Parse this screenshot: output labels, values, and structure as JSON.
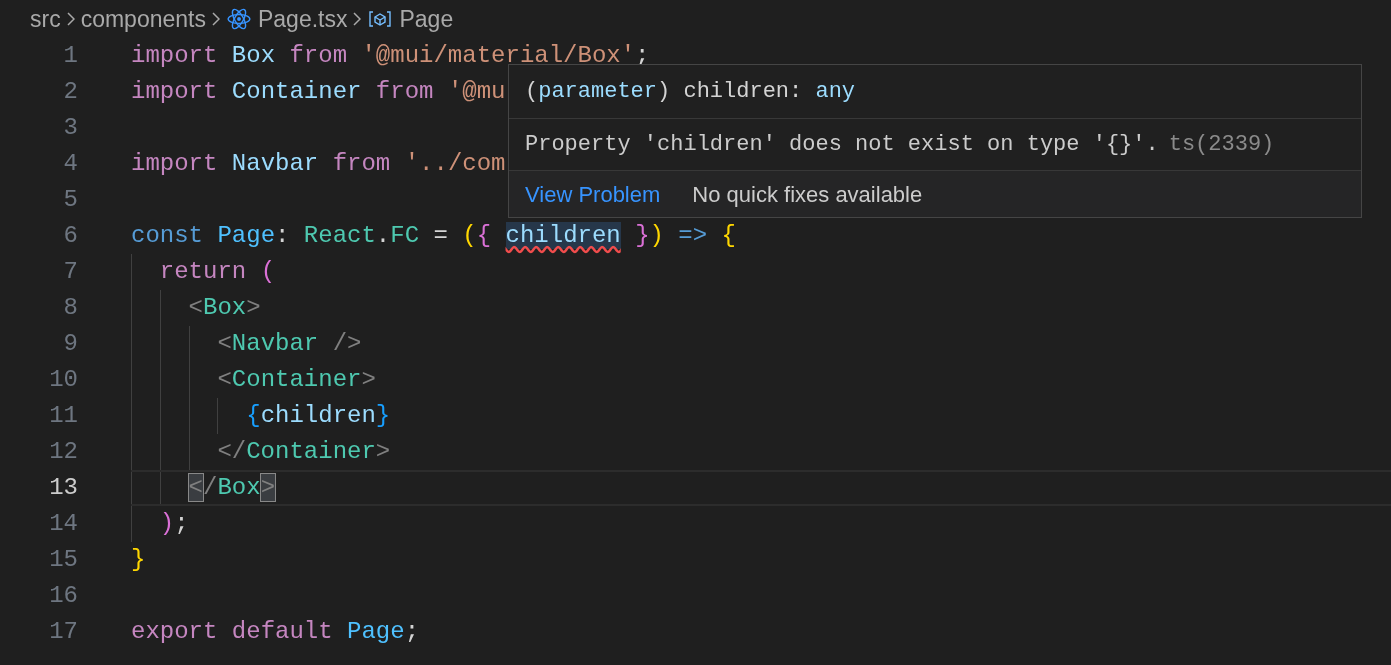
{
  "breadcrumb": [
    {
      "label": "src"
    },
    {
      "label": "components"
    },
    {
      "label": "Page.tsx",
      "kind": "react"
    },
    {
      "label": "Page",
      "kind": "symbol"
    }
  ],
  "lines": [
    {
      "number": "1",
      "selected": false,
      "tokens": [
        {
          "text": "import ",
          "kind": "keyword"
        },
        {
          "text": "Box ",
          "kind": "variable"
        },
        {
          "text": "from ",
          "kind": "keyword"
        },
        {
          "text": "'@mui/material/Box'",
          "kind": "string"
        },
        {
          "text": ";",
          "kind": "punct"
        }
      ]
    },
    {
      "number": "2",
      "selected": false,
      "tokens": [
        {
          "text": "import ",
          "kind": "keyword"
        },
        {
          "text": "Container ",
          "kind": "variable"
        },
        {
          "text": "from ",
          "kind": "keyword"
        },
        {
          "text": "'@mu",
          "kind": "string"
        }
      ]
    },
    {
      "number": "3",
      "selected": false
    },
    {
      "number": "4",
      "selected": false,
      "tokens": [
        {
          "text": "import ",
          "kind": "keyword"
        },
        {
          "text": "Navbar ",
          "kind": "variable"
        },
        {
          "text": "from ",
          "kind": "keyword"
        },
        {
          "text": "'../com",
          "kind": "string"
        }
      ]
    },
    {
      "number": "5",
      "selected": false
    },
    {
      "number": "6",
      "selected": false,
      "tokens": [
        {
          "text": "const ",
          "kind": "storage"
        },
        {
          "text": "Page",
          "kind": "function"
        },
        {
          "text": ": ",
          "kind": "punct"
        },
        {
          "text": "React",
          "kind": "type"
        },
        {
          "text": ".",
          "kind": "punct"
        },
        {
          "text": "FC",
          "kind": "type"
        },
        {
          "text": " = ",
          "kind": "punct"
        },
        {
          "text": "(",
          "kind": "bracket1"
        },
        {
          "text": "{ ",
          "kind": "bracket2"
        },
        {
          "text": "children",
          "kind": "error"
        },
        {
          "text": " }",
          "kind": "bracket2"
        },
        {
          "text": ")",
          "kind": "bracket1"
        },
        {
          "text": " => ",
          "kind": "storage"
        },
        {
          "text": "{",
          "kind": "bracket1"
        }
      ]
    },
    {
      "number": "7",
      "selected": false,
      "tokens": [
        {
          "text": "  return ",
          "kind": "keyword"
        },
        {
          "text": "(",
          "kind": "bracket2"
        }
      ]
    },
    {
      "number": "8",
      "selected": false,
      "tokens": [
        {
          "text": "    <",
          "kind": "tagpunct"
        },
        {
          "text": "Box",
          "kind": "tag"
        },
        {
          "text": ">",
          "kind": "tagpunct"
        }
      ]
    },
    {
      "number": "9",
      "selected": false,
      "tokens": [
        {
          "text": "      <",
          "kind": "tagpunct"
        },
        {
          "text": "Navbar",
          "kind": "tag"
        },
        {
          "text": " />",
          "kind": "tagpunct"
        }
      ]
    },
    {
      "number": "10",
      "selected": false,
      "tokens": [
        {
          "text": "      <",
          "kind": "tagpunct"
        },
        {
          "text": "Container",
          "kind": "tag"
        },
        {
          "text": ">",
          "kind": "tagpunct"
        }
      ]
    },
    {
      "number": "11",
      "selected": false,
      "tokens": [
        {
          "text": "        {",
          "kind": "bracket3"
        },
        {
          "text": "children",
          "kind": "variable"
        },
        {
          "text": "}",
          "kind": "bracket3"
        }
      ]
    },
    {
      "number": "12",
      "selected": false,
      "tokens": [
        {
          "text": "      </",
          "kind": "tagpunct"
        },
        {
          "text": "Container",
          "kind": "tag"
        },
        {
          "text": ">",
          "kind": "tagpunct"
        }
      ]
    },
    {
      "number": "13",
      "selected": true,
      "tokens": [
        {
          "text": "    <",
          "kind": "matched"
        },
        {
          "text": "/",
          "kind": "tagpunct"
        },
        {
          "text": "Box",
          "kind": "tag"
        },
        {
          "text": ">",
          "kind": "matched"
        }
      ]
    },
    {
      "number": "14",
      "selected": false,
      "tokens": [
        {
          "text": "  )",
          "kind": "bracket2"
        },
        {
          "text": ";",
          "kind": "punct"
        }
      ]
    },
    {
      "number": "15",
      "selected": false,
      "tokens": [
        {
          "text": "}",
          "kind": "bracket1"
        }
      ]
    },
    {
      "number": "16",
      "selected": false
    },
    {
      "number": "17",
      "selected": false,
      "tokens": [
        {
          "text": "export ",
          "kind": "keyword"
        },
        {
          "text": "default ",
          "kind": "keyword"
        },
        {
          "text": "Page",
          "kind": "function"
        },
        {
          "text": ";",
          "kind": "punct"
        }
      ]
    }
  ],
  "hover": {
    "signature": [
      {
        "text": "(",
        "kind": "punct"
      },
      {
        "text": "parameter",
        "kind": "variable"
      },
      {
        "text": ") children: ",
        "kind": "punct"
      },
      {
        "text": "any",
        "kind": "variable"
      }
    ],
    "message": "Property 'children' does not exist on type '{}'.",
    "code": "ts(2339)",
    "link": "View Problem",
    "note": "No quick fixes available"
  }
}
